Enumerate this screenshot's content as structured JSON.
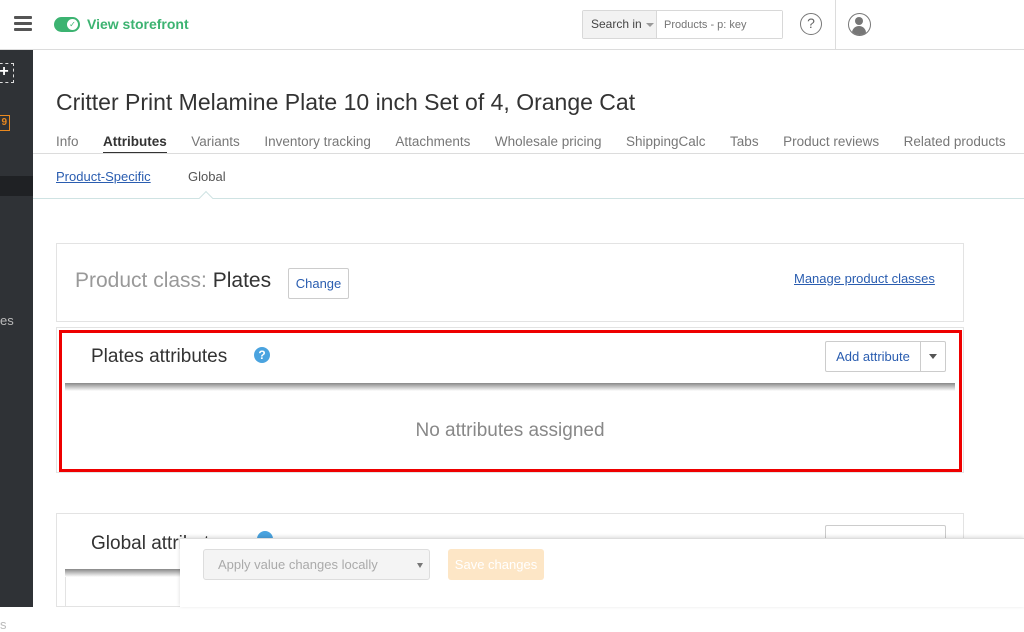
{
  "topbar": {
    "storefront_label": "View storefront",
    "search": {
      "scope_label": "Search in",
      "placeholder": "Products - p: key"
    },
    "help_glyph": "?"
  },
  "sidebar": {
    "badge_text": "9",
    "item_text_1": "es",
    "item_text_2": "s"
  },
  "product": {
    "title": "Critter Print Melamine Plate 10 inch Set of 4, Orange Cat"
  },
  "tabs": [
    {
      "label": "Info"
    },
    {
      "label": "Attributes"
    },
    {
      "label": "Variants"
    },
    {
      "label": "Inventory tracking"
    },
    {
      "label": "Attachments"
    },
    {
      "label": "Wholesale pricing"
    },
    {
      "label": "ShippingCalc"
    },
    {
      "label": "Tabs"
    },
    {
      "label": "Product reviews"
    },
    {
      "label": "Related products"
    }
  ],
  "subtabs": {
    "product_specific": "Product-Specific",
    "global": "Global"
  },
  "product_class": {
    "label": "Product class:",
    "value": "Plates",
    "change_label": "Change",
    "manage_link": "Manage product classes"
  },
  "class_attributes": {
    "title": "Plates attributes",
    "add_label": "Add attribute",
    "empty_message": "No attributes assigned"
  },
  "global_attributes": {
    "title": "Global attributes"
  },
  "bottom_bar": {
    "apply_option": "Apply value changes locally",
    "save_label": "Save changes"
  },
  "colors": {
    "accent_green": "#3cb371",
    "link_blue": "#2a5db0",
    "highlight_red": "#ee0000",
    "save_disabled": "#fde6c6"
  }
}
